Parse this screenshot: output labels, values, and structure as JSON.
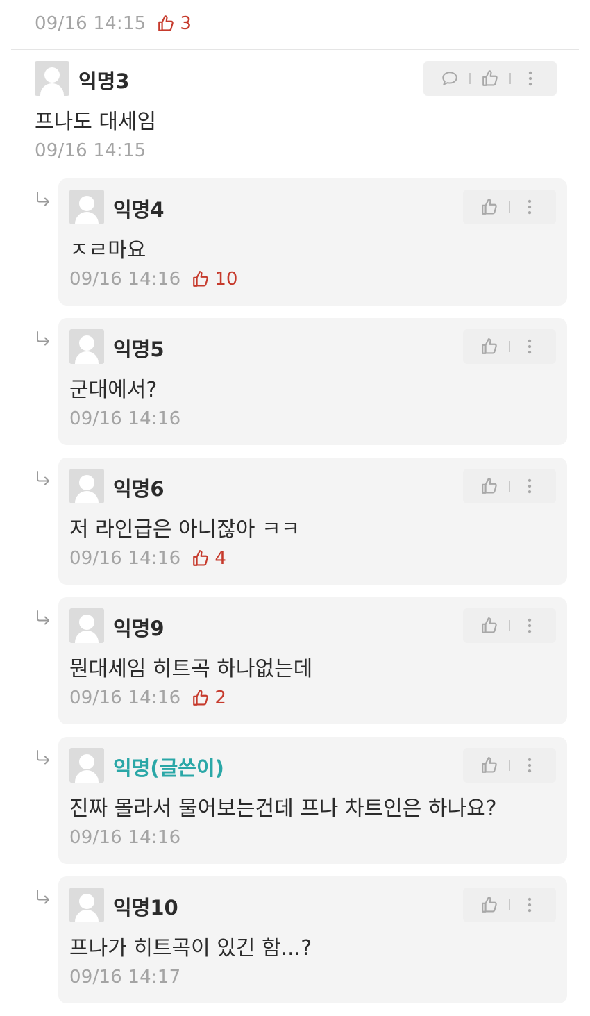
{
  "top": {
    "time": "09/16 14:15",
    "likes": "3"
  },
  "comment3": {
    "nickname": "익명3",
    "text": "프나도 대세임",
    "time": "09/16 14:15"
  },
  "replies": [
    {
      "nickname": "익명4",
      "text": "ㅈㄹ마요",
      "time": "09/16 14:16",
      "likes": "10"
    },
    {
      "nickname": "익명5",
      "text": "군대에서?",
      "time": "09/16 14:16",
      "likes": ""
    },
    {
      "nickname": "익명6",
      "text": "저 라인급은 아니잖아 ㅋㅋ",
      "time": "09/16 14:16",
      "likes": "4"
    },
    {
      "nickname": "익명9",
      "text": "뭔대세임 히트곡 하나없는데",
      "time": "09/16 14:16",
      "likes": "2"
    },
    {
      "nickname": "익명(글쓴이)",
      "text": "진짜 몰라서 물어보는건데 프나 차트인은 하나요?",
      "time": "09/16 14:16",
      "likes": "",
      "is_author": true
    },
    {
      "nickname": "익명10",
      "text": "프나가 히트곡이 있긴 함...?",
      "time": "09/16 14:17",
      "likes": ""
    }
  ],
  "icons": {
    "like": "thumbs-up-icon",
    "comment": "speech-bubble-icon",
    "more": "vertical-dots-icon",
    "reply": "reply-arrow-icon",
    "avatar": "default-avatar-icon"
  },
  "colors": {
    "like_red": "#c63a2c",
    "author_teal": "#2aa7a7",
    "meta_gray": "#a4a4a4",
    "reply_bg": "#f4f4f4"
  }
}
